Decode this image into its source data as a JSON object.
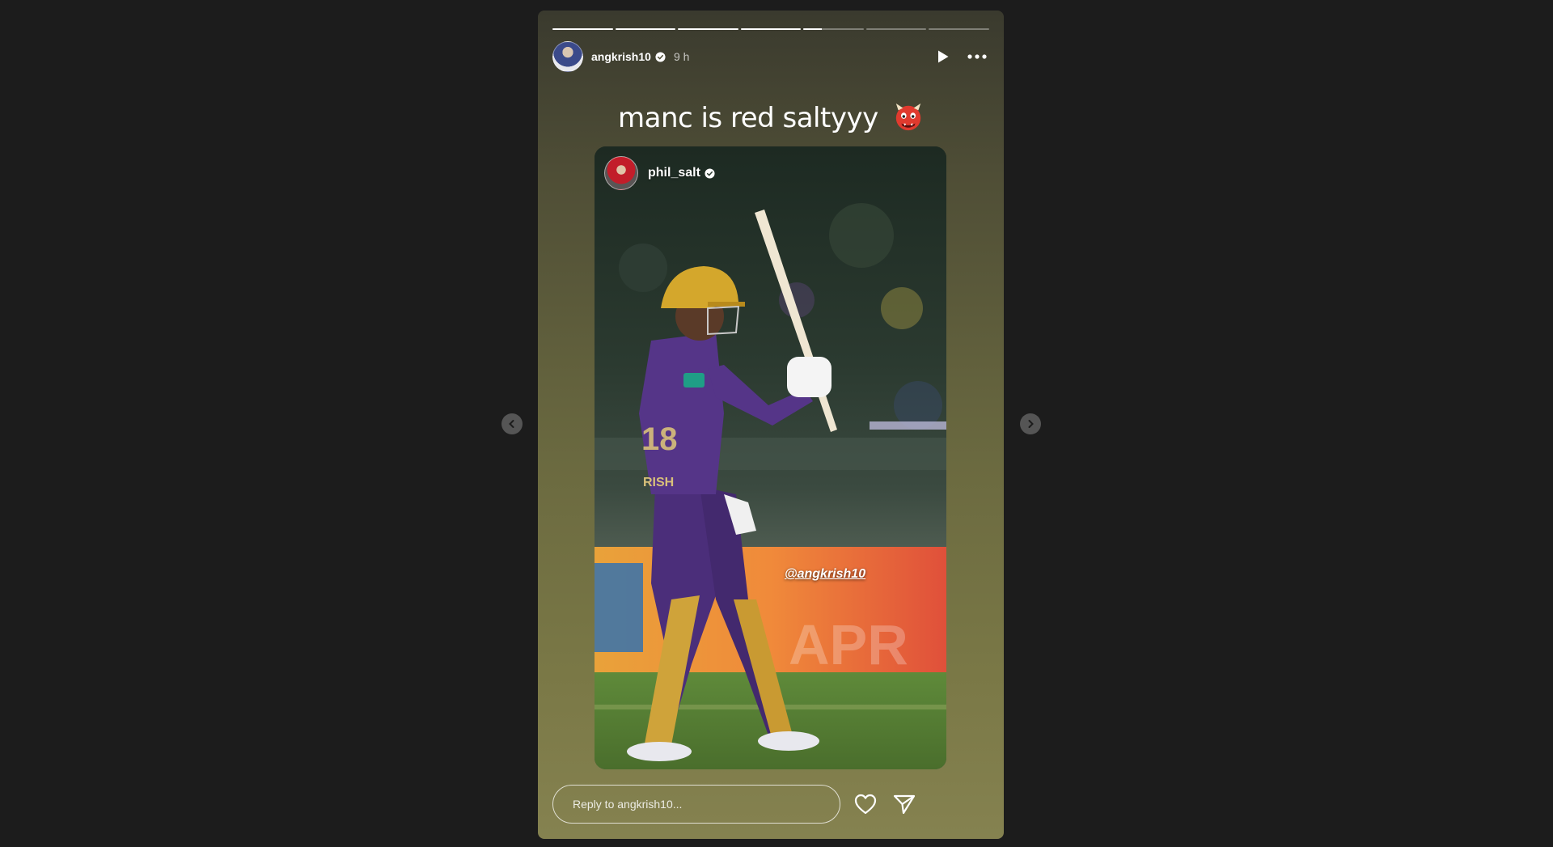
{
  "story": {
    "username": "angkrish10",
    "time": "9 h",
    "progress_segments": [
      1,
      1,
      1,
      1,
      0.3,
      0,
      0
    ],
    "caption": "manc is red saltyyy",
    "caption_emoji": "ogre-emoji"
  },
  "reshared_post": {
    "username": "phil_salt",
    "mention": "@angkrish10",
    "image_description_icon": "cricketer-photo"
  },
  "footer": {
    "reply_placeholder": "Reply to angkrish10...",
    "like_icon": "heart-icon",
    "share_icon": "send-icon"
  },
  "controls": {
    "play_icon": "play-icon",
    "more_icon": "more-icon",
    "prev_icon": "chevron-left-icon",
    "next_icon": "chevron-right-icon"
  },
  "colors": {
    "page_bg": "#1c1c1c",
    "card_top": "#3a3a2e",
    "card_bottom": "#858250",
    "jersey_purple": "#4b2e7a",
    "helmet_gold": "#d4a72c"
  }
}
